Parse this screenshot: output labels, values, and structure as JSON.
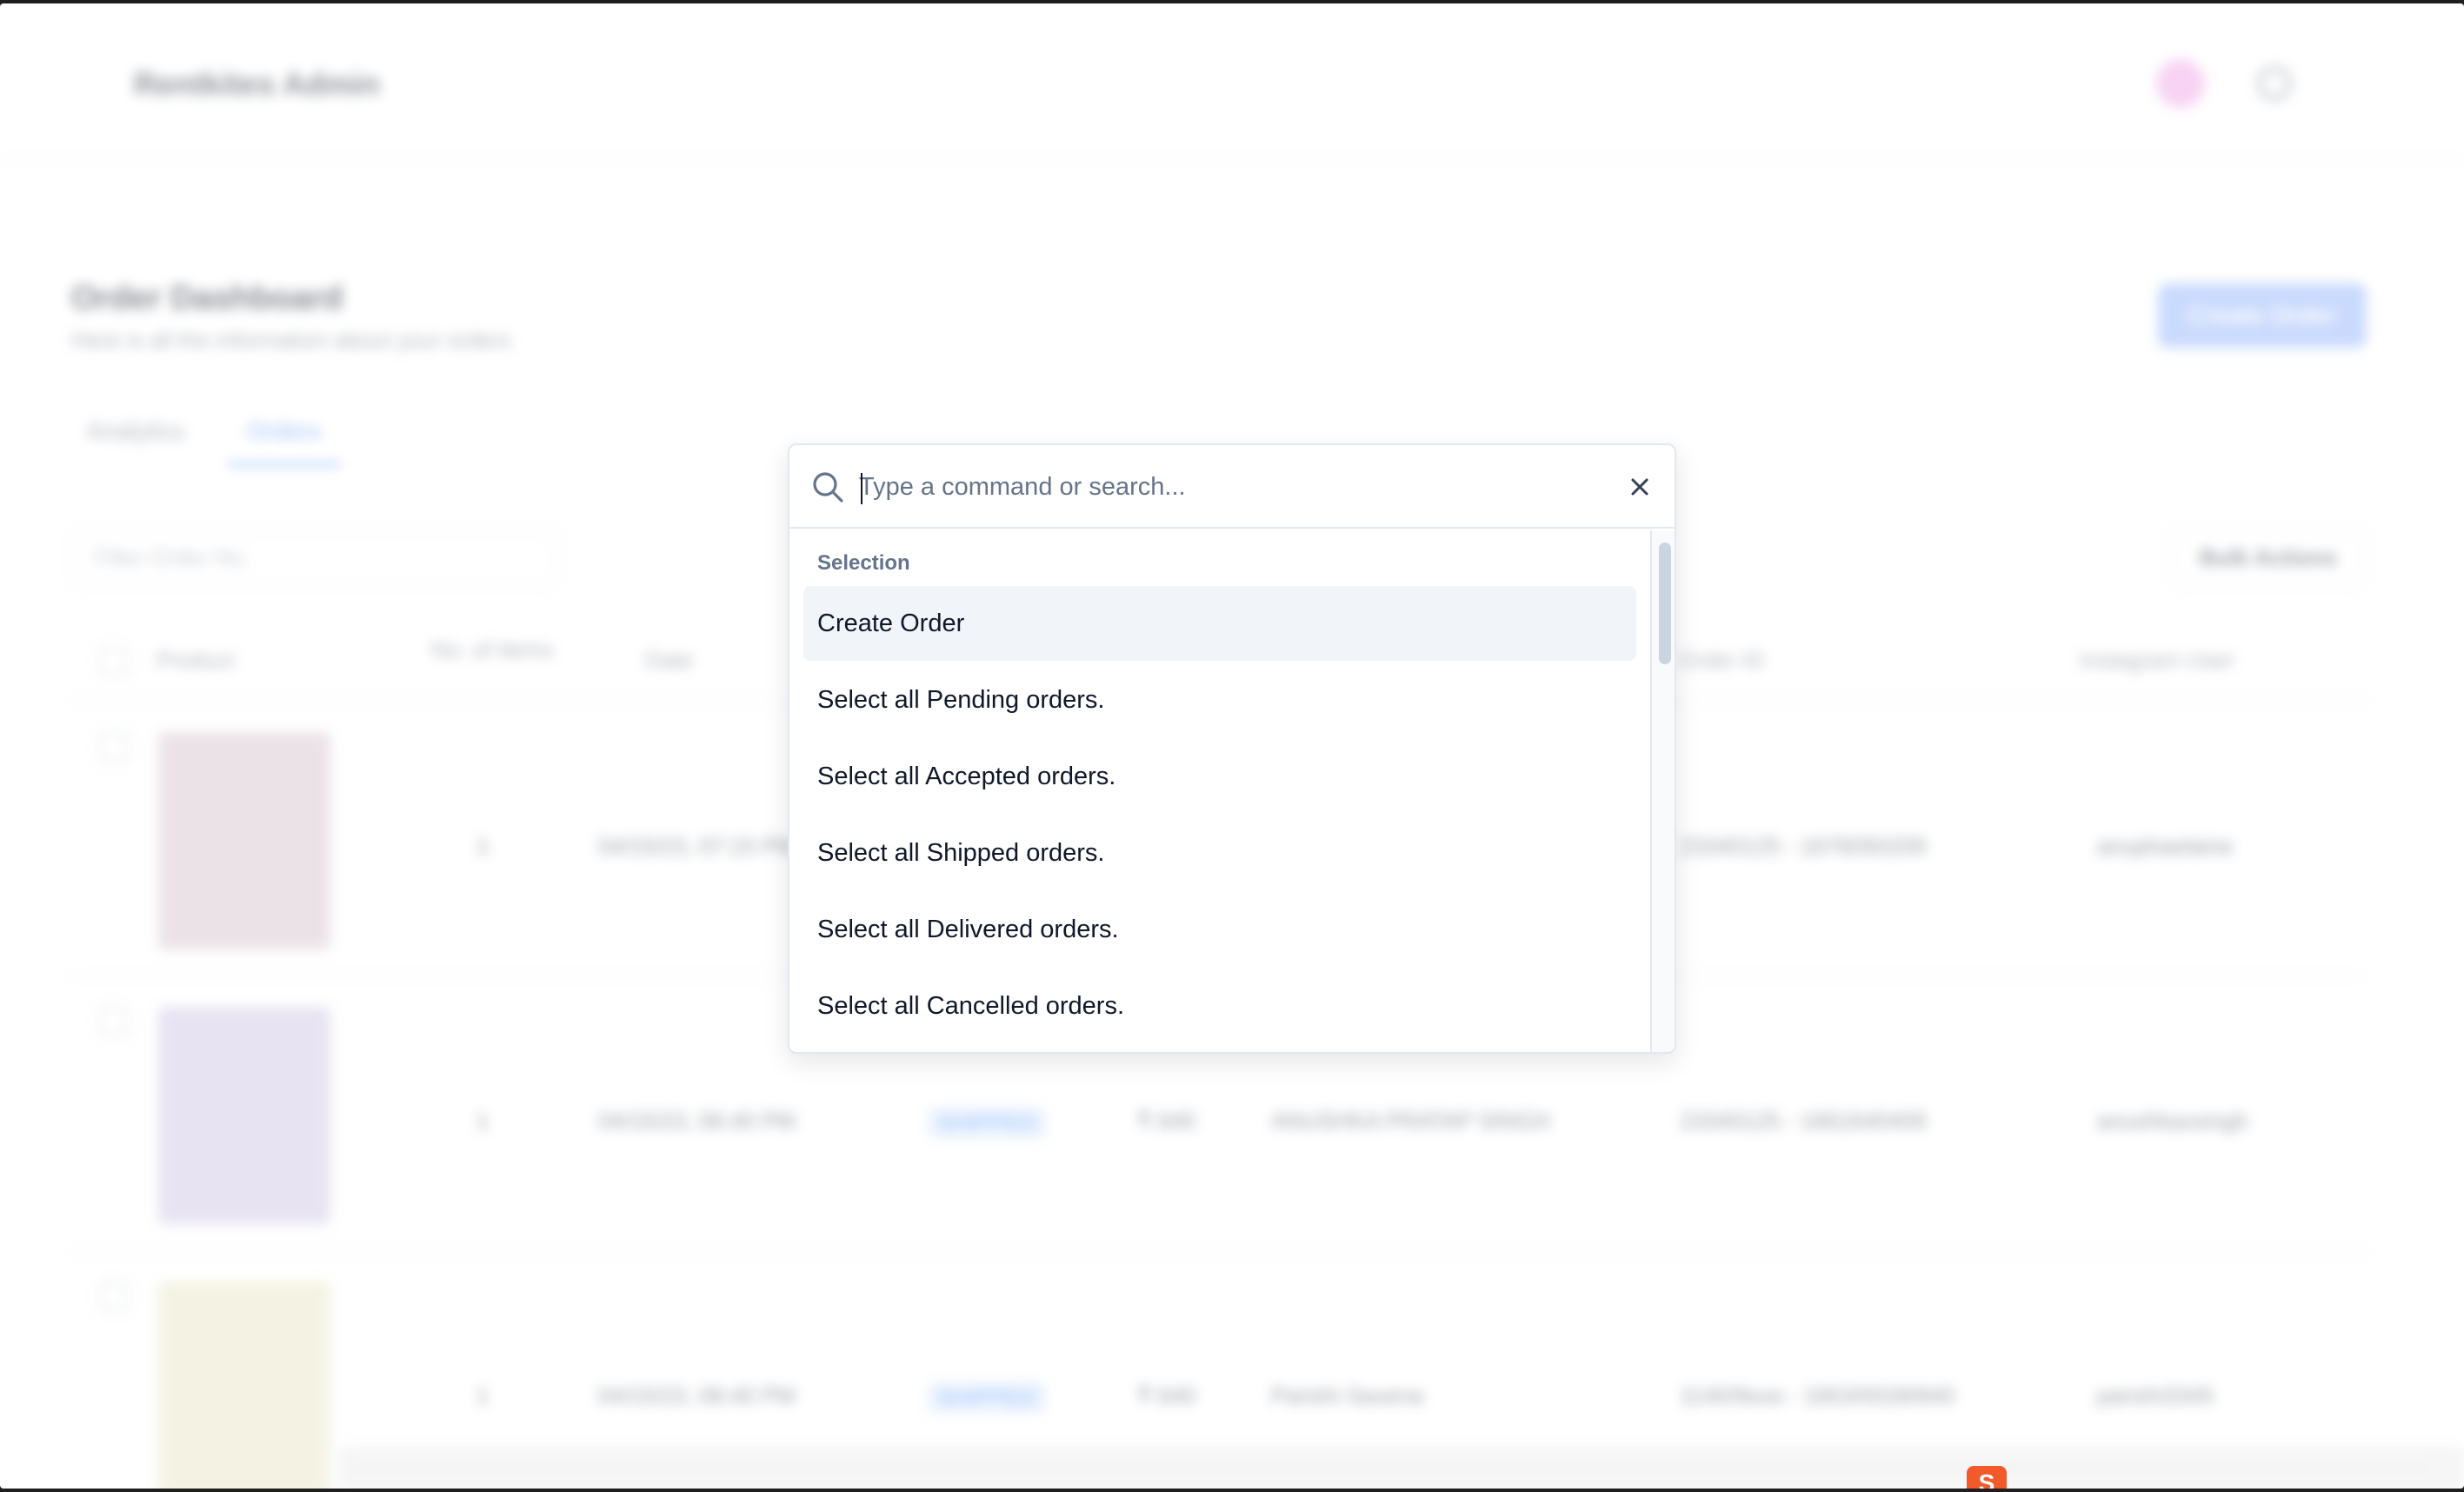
{
  "app": {
    "brand": "Rentkites Admin",
    "dashboard_title": "Order Dashboard",
    "dashboard_subtitle": "Here is all the information about your orders",
    "create_order_button": "Create Order",
    "tabs": [
      "Analytics",
      "Orders"
    ],
    "filter_placeholder": "Filter Order No.",
    "bulk_actions_button": "Bulk Actions",
    "columns": [
      "Product",
      "No. of Items",
      "Date",
      "Order ID",
      "Instagram User"
    ],
    "rows": [
      {
        "items": "1",
        "date": "04/15/23, 07:15 PM",
        "status": "",
        "price": "",
        "customer": "",
        "order_id": "23340125 - 1676050209",
        "instagram": "anuphaelaine",
        "thumb_color": "#d7c5cf"
      },
      {
        "items": "1",
        "date": "04/15/23, 06:40 PM",
        "status": "SHIPPED",
        "price": "₹ 640",
        "customer": "ANUSHKA PRATAP SINGH",
        "order_id": "23340125 - 1661640409",
        "instagram": "anushkaxsingh",
        "thumb_color": "#cfc8e6"
      },
      {
        "items": "1",
        "date": "04/15/23, 06:40 PM",
        "status": "SHIPPED",
        "price": "₹ 640",
        "customer": "Parishi Saxena",
        "order_id": "1140/9oxe - 1653/0028/840",
        "instagram": "parishi3345",
        "thumb_color": "#e9e7c8"
      }
    ]
  },
  "command_palette": {
    "search_placeholder": "Type a command or search...",
    "search_value": "",
    "group_heading": "Selection",
    "items": [
      {
        "label": "Create Order",
        "active": true
      },
      {
        "label": "Select all Pending orders.",
        "active": false
      },
      {
        "label": "Select all Accepted orders.",
        "active": false
      },
      {
        "label": "Select all Shipped orders.",
        "active": false
      },
      {
        "label": "Select all Delivered orders.",
        "active": false
      },
      {
        "label": "Select all Cancelled orders.",
        "active": false
      }
    ]
  },
  "badge": {
    "label": "S",
    "color": "#f25a2b"
  },
  "colors": {
    "accent": "#3b82f6",
    "highlight": "#f1f5f9",
    "muted_text": "#64748b"
  },
  "icons": [
    "search-icon",
    "close-icon",
    "gear-icon",
    "avatar"
  ]
}
